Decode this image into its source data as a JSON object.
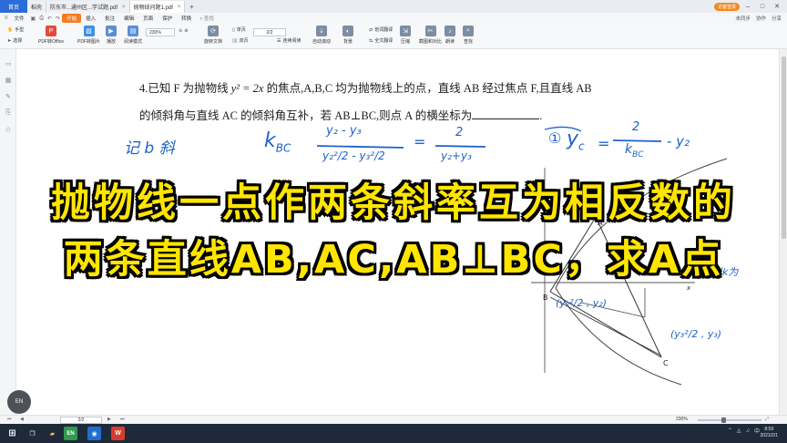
{
  "tabs": {
    "home": "首页",
    "items": [
      {
        "label": "稻壳",
        "color": "#e34c3b"
      },
      {
        "label": "防东市...通州区...学试题.pdf",
        "color": "#e34c3b"
      },
      {
        "label": "抛物线问题1.pdf",
        "color": "#e34c3b",
        "active": true
      }
    ],
    "login": "访客登录"
  },
  "menu": {
    "file": "文件",
    "start": "开始",
    "items": [
      "插入",
      "批注",
      "编辑",
      "页面",
      "保护",
      "转换"
    ],
    "search": "查找",
    "right": [
      "未同步",
      "协作",
      "分享"
    ]
  },
  "toolbar": {
    "hand": "手型",
    "select": "选择",
    "pdf_office": "PDF转Office",
    "pdf_image": "PDF转图片",
    "play": "播放",
    "read_mode": "阅读模式",
    "zoom": "230%",
    "rotate": "旋转文档",
    "single": "单页",
    "double": "双页",
    "continuous": "连续阅读",
    "page": "2/2",
    "auto_scroll": "自动滚动",
    "background": "背景",
    "translate": "划词翻译",
    "full_translate": "全文翻译",
    "compress": "压缩",
    "screenshot": "截图和对比",
    "read_aloud": "朗读",
    "find": "查找"
  },
  "problem": {
    "line1_a": "4.已知 F 为抛物线 ",
    "eq": "y² = 2x",
    "line1_b": " 的焦点,A,B,C 均为抛物线上的点，直线 AB 经过焦点 F,且直线 AB",
    "line2": "的倾斜角与直线 AC 的倾斜角互补，若 AB⊥BC,则点 A 的横坐标为",
    "line2_end": "."
  },
  "handwriting": {
    "label1": "记 b 斜",
    "kbc": "k",
    "kbc_sub": "BC",
    "frac_num": "y₂ - y₃",
    "frac_den": "y₂²/2 - y₃²/2",
    "eq_sign": "=",
    "frac2_num": "2",
    "frac2_den": "y₂+y₃",
    "circle1": "①",
    "yc": "y",
    "yc_sub": "c",
    "yc_rhs_num": "2",
    "yc_rhs_den": "k",
    "yc_rhs_den_sub": "BC",
    "yc_tail": "- y₂",
    "pointB": "(y₂²/2 , y₂)",
    "pointC": "(y₃²/2 , y₃)",
    "note_right": "以k为",
    "labelA": "A",
    "labelB": "B",
    "labelC": "C",
    "labelX": "x"
  },
  "caption": {
    "line1": "抛物线一点作两条斜率互为相反数的",
    "line2": "两条直线AB,AC,AB⊥BC，求A点"
  },
  "status": {
    "page": "2/2",
    "zoom": "230%"
  },
  "taskbar": {
    "time": "8:59",
    "date": "2021/2/1",
    "lang": "EN"
  }
}
